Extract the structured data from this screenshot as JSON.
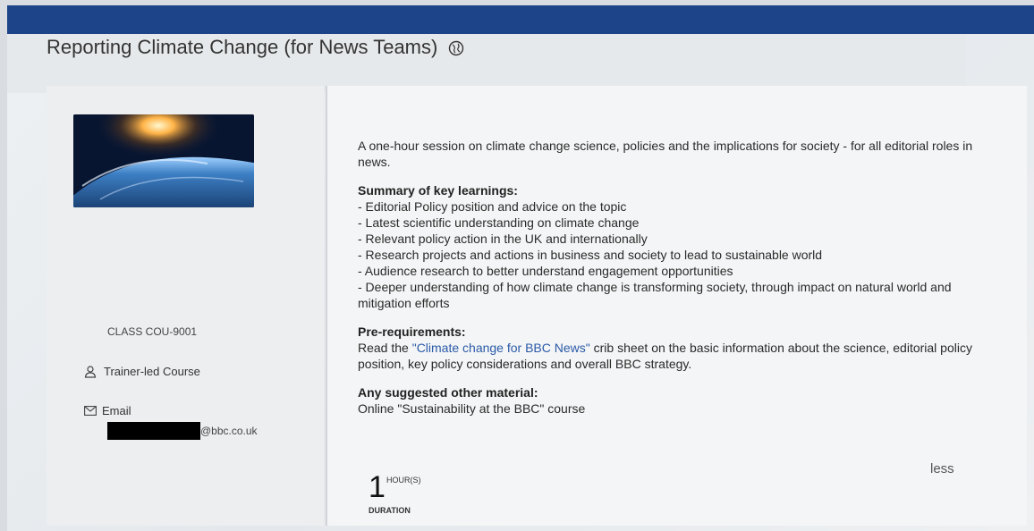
{
  "header": {
    "title": "Reporting Climate Change (for News Teams)",
    "title_icon": "globe-icon",
    "bar_color": "#1d4489"
  },
  "sidebar": {
    "thumbnail_icon": "earth-from-space-image",
    "class_code": "CLASS COU-9001",
    "course_type": "Trainer-led Course",
    "course_type_icon": "person-icon",
    "email_label": "Email",
    "email_icon": "envelope-icon",
    "email_domain": "@bbc.co.uk"
  },
  "description": {
    "intro": "A one-hour session on climate change science, policies and the implications for society - for all editorial roles in news.",
    "summary_heading": "Summary of key learnings:",
    "summary_items": [
      "- Editorial Policy position and advice on the topic",
      "- Latest scientific understanding on climate change",
      "- Relevant policy action in the UK and internationally",
      "- Research projects and actions in business and society to lead to sustainable world",
      "- Audience research to better understand engagement opportunities",
      "- Deeper understanding of how climate change is transforming society, through impact on natural world and mitigation efforts"
    ],
    "prereq_heading": "Pre-requirements:",
    "prereq_before": "Read the ",
    "prereq_link": "\"Climate change for BBC News\"",
    "prereq_after": " crib sheet on the basic information about the science, editorial policy position, key policy considerations and overall BBC strategy.",
    "other_heading": "Any suggested other material:",
    "other_text": "Online \"Sustainability at the BBC\" course",
    "less_link": "less"
  },
  "duration": {
    "value": "1",
    "unit": "HOUR(S)",
    "label": "DURATION"
  }
}
